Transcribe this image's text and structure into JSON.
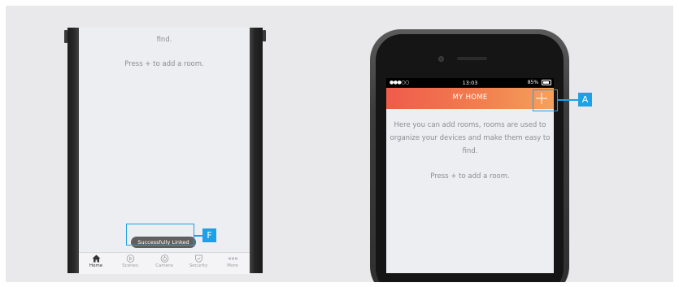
{
  "left_phone": {
    "text_line_find": "find.",
    "text_press": "Press + to add a room.",
    "toast": "Successfully Linked",
    "callout_label": "F",
    "tabs": [
      {
        "label": "Home",
        "icon": "home-icon",
        "active": true
      },
      {
        "label": "Scenes",
        "icon": "scenes-icon",
        "active": false
      },
      {
        "label": "Camera",
        "icon": "camera-icon",
        "active": false
      },
      {
        "label": "Security",
        "icon": "shield-icon",
        "active": false
      },
      {
        "label": "More",
        "icon": "more-icon",
        "active": false
      }
    ]
  },
  "right_phone": {
    "status": {
      "signal": "●●●○○",
      "time": "13:03",
      "battery": "85%"
    },
    "header_title": "MY HOME",
    "callout_label": "A",
    "description_line1": "Here you can add rooms, rooms are used to",
    "description_line2": "organize your devices and make them easy to",
    "description_line3": "find.",
    "press_text": "Press + to add a room."
  },
  "colors": {
    "accent": "#1da1e6",
    "header_start": "#ef5b4c",
    "header_end": "#f4a25d",
    "screen_bg": "#eceef2",
    "toast_bg": "#5f5f5f"
  }
}
